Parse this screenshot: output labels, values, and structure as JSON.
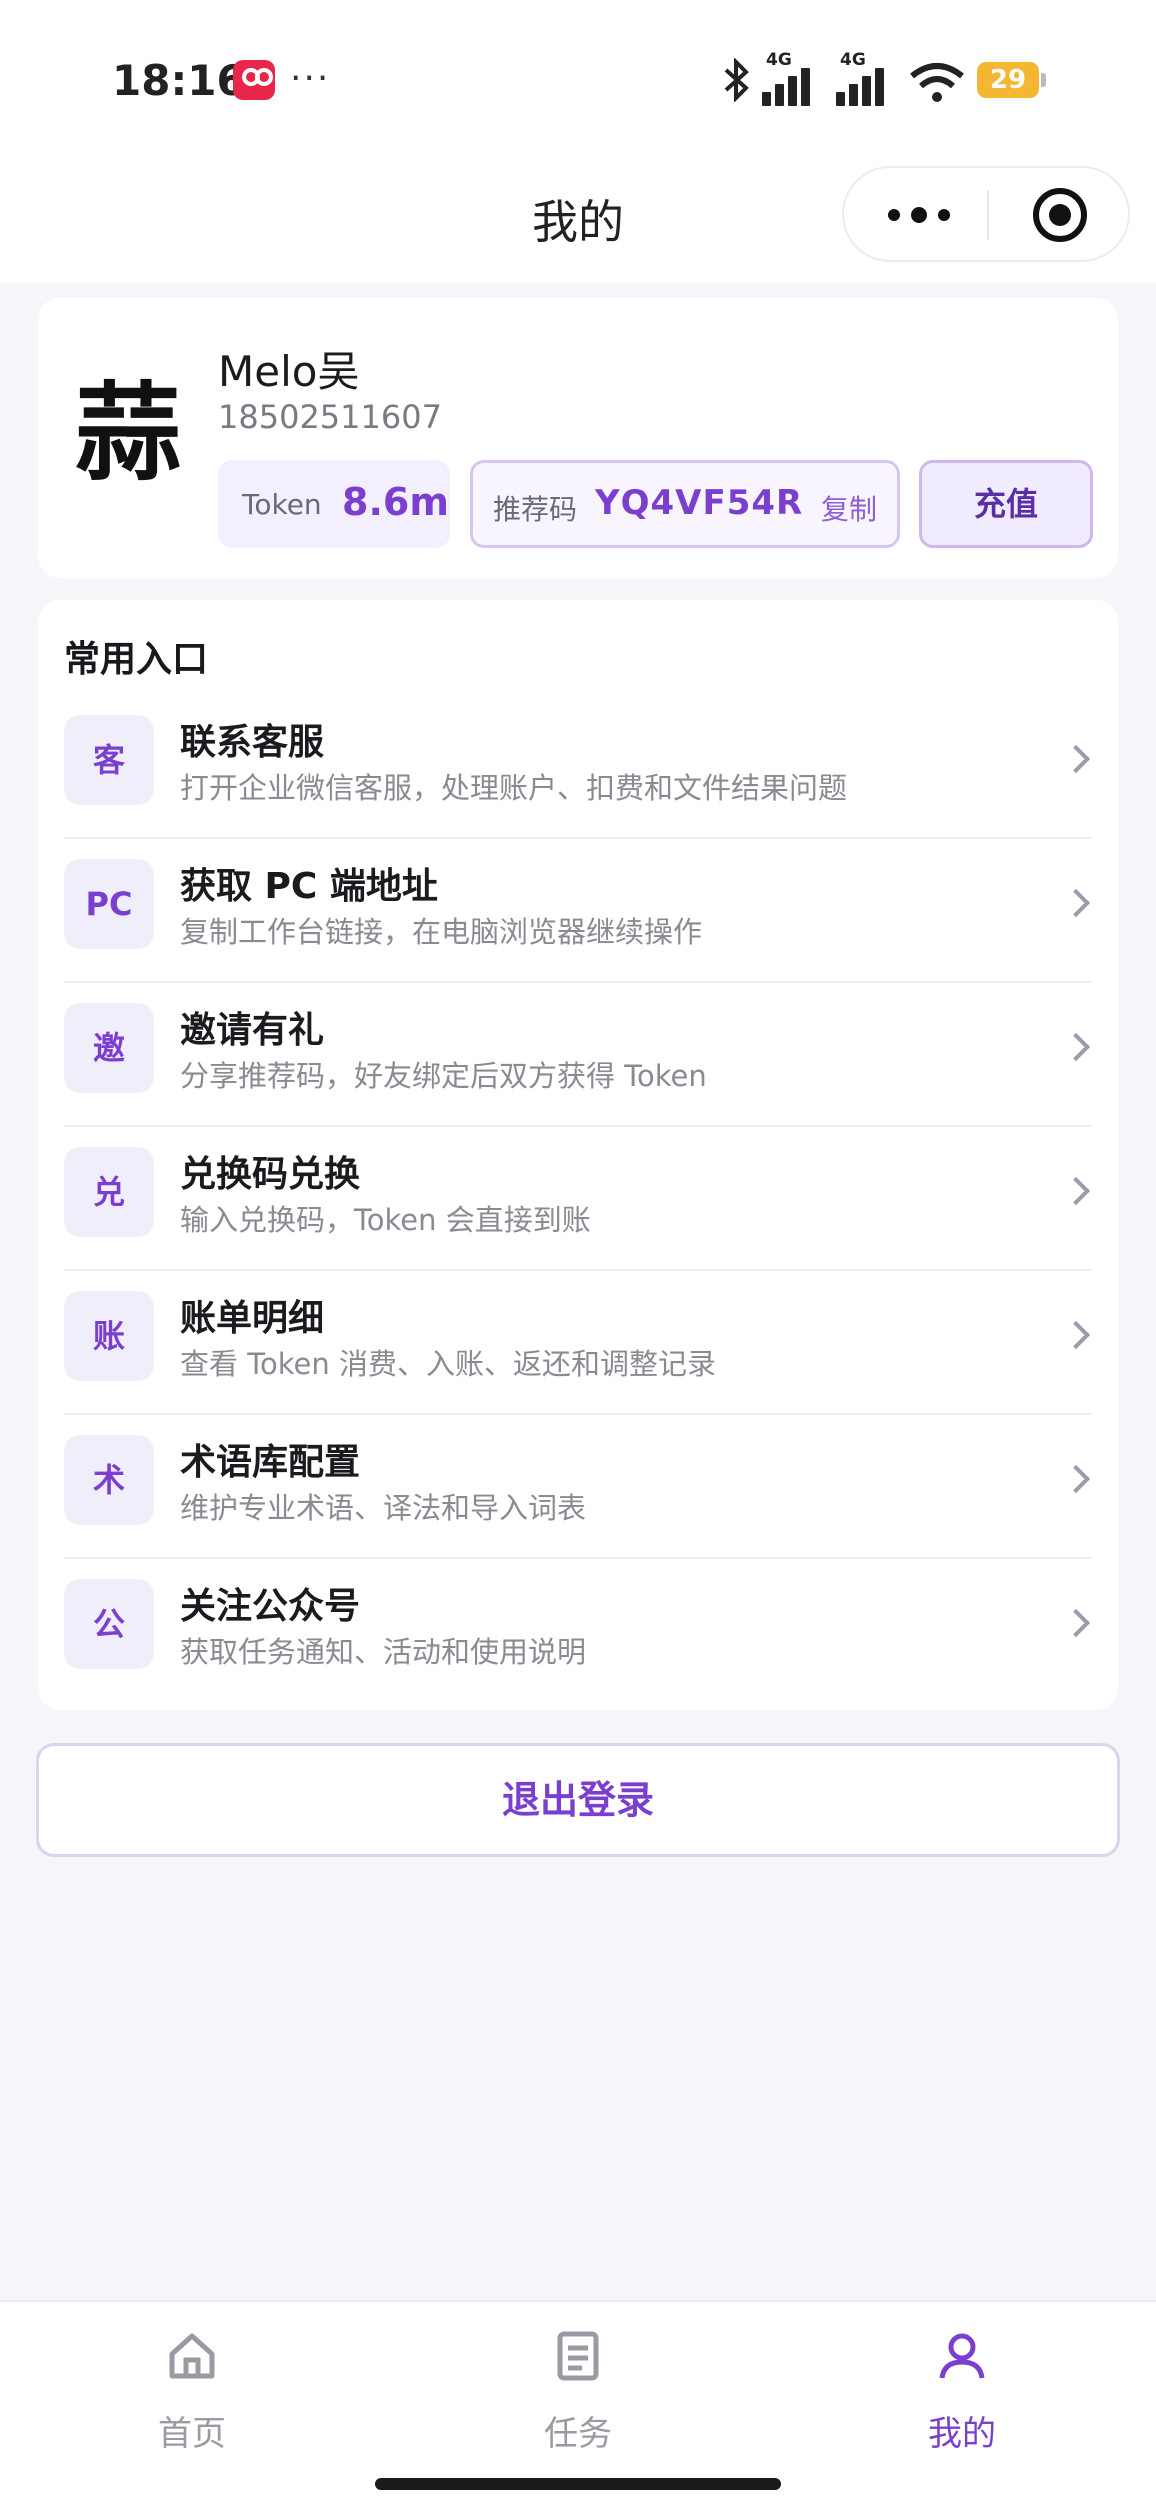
{
  "status_bar": {
    "time": "18:16",
    "more": "···",
    "network_1": "4G",
    "network_2": "4G",
    "battery": "29"
  },
  "nav": {
    "title": "我的"
  },
  "profile": {
    "avatar_char": "蒜",
    "name": "Melo吴",
    "phone": "18502511607",
    "token_label": "Token",
    "token_value": "8.6m",
    "referral_label": "推荐码",
    "referral_code": "YQ4VF54R",
    "copy_label": "复制",
    "recharge_label": "充值"
  },
  "entries": {
    "title": "常用入口",
    "items": [
      {
        "icon": "客",
        "title": "联系客服",
        "subtitle": "打开企业微信客服，处理账户、扣费和文件结果问题"
      },
      {
        "icon": "PC",
        "title": "获取 PC 端地址",
        "subtitle": "复制工作台链接，在电脑浏览器继续操作"
      },
      {
        "icon": "邀",
        "title": "邀请有礼",
        "subtitle": "分享推荐码，好友绑定后双方获得 Token"
      },
      {
        "icon": "兑",
        "title": "兑换码兑换",
        "subtitle": "输入兑换码，Token 会直接到账"
      },
      {
        "icon": "账",
        "title": "账单明细",
        "subtitle": "查看 Token 消费、入账、返还和调整记录"
      },
      {
        "icon": "术",
        "title": "术语库配置",
        "subtitle": "维护专业术语、译法和导入词表"
      },
      {
        "icon": "公",
        "title": "关注公众号",
        "subtitle": "获取任务通知、活动和使用说明"
      }
    ]
  },
  "logout_label": "退出登录",
  "tabbar": {
    "home": "首页",
    "tasks": "任务",
    "mine": "我的"
  },
  "colors": {
    "accent": "#7b3fd0",
    "background": "#f5f6fa"
  }
}
